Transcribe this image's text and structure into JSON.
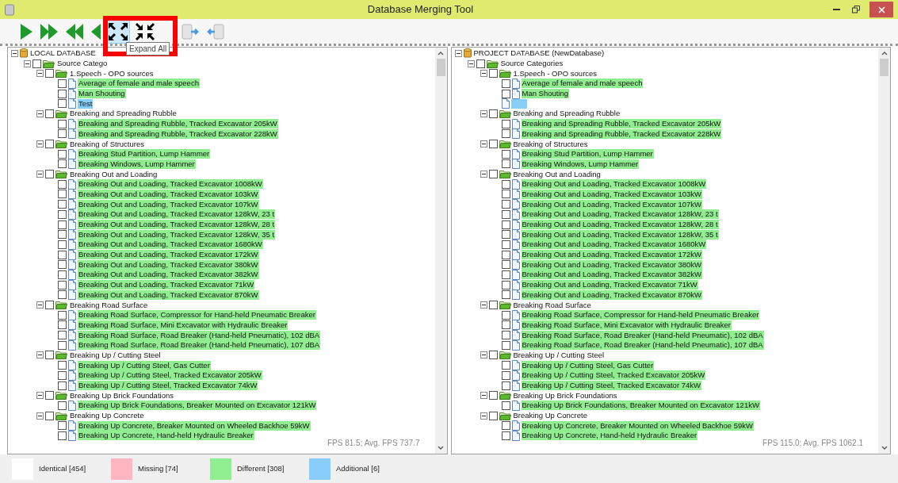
{
  "window": {
    "title": "Database Merging Tool"
  },
  "toolbar": {
    "buttons": [
      {
        "kind": "play",
        "highlighted": false
      },
      {
        "kind": "fast-forward",
        "highlighted": false
      },
      {
        "kind": "rewind",
        "highlighted": false
      },
      {
        "kind": "back",
        "highlighted": false
      },
      {
        "kind": "expand",
        "highlighted": true
      },
      {
        "kind": "collapse",
        "highlighted": false
      },
      {
        "kind": "db-right",
        "highlighted": false
      },
      {
        "kind": "db-left",
        "highlighted": false
      }
    ],
    "tooltip": "Expand All"
  },
  "panels": [
    {
      "fps": "FPS 81.5; Avg. FPS 737.7",
      "tree": {
        "label": "LOCAL DATABASE",
        "kind": "database",
        "children": [
          {
            "label": "Source Catego",
            "kind": "folder",
            "checked": false,
            "children": [
              {
                "label": "1.Speech - OPO sources",
                "kind": "folder",
                "checked": false,
                "children": [
                  {
                    "label": "Average of female and male speech",
                    "kind": "file",
                    "checked": false,
                    "color": "#90ee90"
                  },
                  {
                    "label": "Man Shouting",
                    "kind": "file",
                    "checked": false,
                    "color": "#90ee90"
                  },
                  {
                    "label": "Test",
                    "kind": "file",
                    "checked": false,
                    "color": "#87cefa"
                  }
                ]
              },
              {
                "label": "Breaking and Spreading Rubble",
                "kind": "folder",
                "checked": false,
                "children": [
                  {
                    "label": "Breaking and Spreading Rubble, Tracked Excavator 205kW",
                    "kind": "file",
                    "checked": false,
                    "color": "#90ee90"
                  },
                  {
                    "label": "Breaking and Spreading Rubble, Tracked Excavator 228kW",
                    "kind": "file",
                    "checked": false,
                    "color": "#90ee90"
                  }
                ]
              },
              {
                "label": "Breaking of Structures",
                "kind": "folder",
                "checked": false,
                "children": [
                  {
                    "label": "Breaking Stud Partition, Lump Hammer",
                    "kind": "file",
                    "checked": false,
                    "color": "#90ee90"
                  },
                  {
                    "label": "Breaking Windows, Lump Hammer",
                    "kind": "file",
                    "checked": false,
                    "color": "#90ee90"
                  }
                ]
              },
              {
                "label": "Breaking Out and Loading",
                "kind": "folder",
                "checked": false,
                "children": [
                  {
                    "label": "Breaking Out and Loading, Tracked Excavator 1008kW",
                    "kind": "file",
                    "checked": false,
                    "color": "#90ee90"
                  },
                  {
                    "label": "Breaking Out and Loading, Tracked Excavator 103kW",
                    "kind": "file",
                    "checked": false,
                    "color": "#90ee90"
                  },
                  {
                    "label": "Breaking Out and Loading, Tracked Excavator 107kW",
                    "kind": "file",
                    "checked": false,
                    "color": "#90ee90"
                  },
                  {
                    "label": "Breaking Out and Loading, Tracked Excavator 128kW, 23 t",
                    "kind": "file",
                    "checked": false,
                    "color": "#90ee90"
                  },
                  {
                    "label": "Breaking Out and Loading, Tracked Excavator 128kW, 28 t",
                    "kind": "file",
                    "checked": false,
                    "color": "#90ee90"
                  },
                  {
                    "label": "Breaking Out and Loading, Tracked Excavator 128kW, 35 t",
                    "kind": "file",
                    "checked": false,
                    "color": "#90ee90"
                  },
                  {
                    "label": "Breaking Out and Loading, Tracked Excavator 1680kW",
                    "kind": "file",
                    "checked": false,
                    "color": "#90ee90"
                  },
                  {
                    "label": "Breaking Out and Loading, Tracked Excavator 172kW",
                    "kind": "file",
                    "checked": false,
                    "color": "#90ee90"
                  },
                  {
                    "label": "Breaking Out and Loading, Tracked Excavator 380kW",
                    "kind": "file",
                    "checked": false,
                    "color": "#90ee90"
                  },
                  {
                    "label": "Breaking Out and Loading, Tracked Excavator 382kW",
                    "kind": "file",
                    "checked": false,
                    "color": "#90ee90"
                  },
                  {
                    "label": "Breaking Out and Loading, Tracked Excavator 71kW",
                    "kind": "file",
                    "checked": false,
                    "color": "#90ee90"
                  },
                  {
                    "label": "Breaking Out and Loading, Tracked Excavator 870kW",
                    "kind": "file",
                    "checked": false,
                    "color": "#90ee90"
                  }
                ]
              },
              {
                "label": "Breaking Road Surface",
                "kind": "folder",
                "checked": false,
                "children": [
                  {
                    "label": "Breaking Road Surface, Compressor for Hand-held Pneumatic Breaker",
                    "kind": "file",
                    "checked": false,
                    "color": "#90ee90"
                  },
                  {
                    "label": "Breaking Road Surface, Mini Excavator with Hydraulic Breaker",
                    "kind": "file",
                    "checked": false,
                    "color": "#90ee90"
                  },
                  {
                    "label": "Breaking Road Surface, Road Breaker (Hand-held Pneumatic), 102 dBA",
                    "kind": "file",
                    "checked": false,
                    "color": "#90ee90"
                  },
                  {
                    "label": "Breaking Road Surface, Road Breaker (Hand-held Pneumatic), 107 dBA",
                    "kind": "file",
                    "checked": false,
                    "color": "#90ee90"
                  }
                ]
              },
              {
                "label": "Breaking Up / Cutting Steel",
                "kind": "folder",
                "checked": false,
                "children": [
                  {
                    "label": "Breaking Up / Cutting Steel, Gas Cutter",
                    "kind": "file",
                    "checked": false,
                    "color": "#90ee90"
                  },
                  {
                    "label": "Breaking Up / Cutting Steel, Tracked Excavator 205kW",
                    "kind": "file",
                    "checked": false,
                    "color": "#90ee90"
                  },
                  {
                    "label": "Breaking Up / Cutting Steel, Tracked Excavator 74kW",
                    "kind": "file",
                    "checked": false,
                    "color": "#90ee90"
                  }
                ]
              },
              {
                "label": "Breaking Up Brick Foundations",
                "kind": "folder",
                "checked": false,
                "children": [
                  {
                    "label": "Breaking Up Brick Foundations, Breaker Mounted on Excavator 121kW",
                    "kind": "file",
                    "checked": false,
                    "color": "#90ee90"
                  }
                ]
              },
              {
                "label": "Breaking Up Concrete",
                "kind": "folder",
                "checked": false,
                "children": [
                  {
                    "label": "Breaking Up Concrete, Breaker Mounted on Wheeled Backhoe 59kW",
                    "kind": "file",
                    "checked": false,
                    "color": "#90ee90"
                  },
                  {
                    "label": "Breaking Up Concrete, Hand-held Hydraulic Breaker",
                    "kind": "file",
                    "checked": false,
                    "color": "#90ee90"
                  }
                ]
              }
            ]
          }
        ]
      }
    },
    {
      "fps": "FPS 115.0; Avg. FPS 1062.1",
      "tree": {
        "label": "PROJECT DATABASE (NewDatabase)",
        "kind": "database",
        "children": [
          {
            "label": "Source Categories",
            "kind": "folder",
            "checked": false,
            "children": [
              {
                "label": "1.Speech - OPO sources",
                "kind": "folder",
                "checked": false,
                "children": [
                  {
                    "label": "Average of female and male speech",
                    "kind": "file",
                    "checked": false,
                    "color": "#90ee90"
                  },
                  {
                    "label": "Man Shouting",
                    "kind": "file",
                    "checked": false,
                    "color": "#90ee90"
                  },
                  {
                    "kind": "file",
                    "color": "#87cefa"
                  }
                ]
              },
              {
                "label": "Breaking and Spreading Rubble",
                "kind": "folder",
                "checked": false,
                "children": [
                  {
                    "label": "Breaking and Spreading Rubble, Tracked Excavator 205kW",
                    "kind": "file",
                    "checked": false,
                    "color": "#90ee90"
                  },
                  {
                    "label": "Breaking and Spreading Rubble, Tracked Excavator 228kW",
                    "kind": "file",
                    "checked": false,
                    "color": "#90ee90"
                  }
                ]
              },
              {
                "label": "Breaking of Structures",
                "kind": "folder",
                "checked": false,
                "children": [
                  {
                    "label": "Breaking Stud Partition, Lump Hammer",
                    "kind": "file",
                    "checked": false,
                    "color": "#90ee90"
                  },
                  {
                    "label": "Breaking Windows, Lump Hammer",
                    "kind": "file",
                    "checked": false,
                    "color": "#90ee90"
                  }
                ]
              },
              {
                "label": "Breaking Out and Loading",
                "kind": "folder",
                "checked": false,
                "children": [
                  {
                    "label": "Breaking Out and Loading, Tracked Excavator 1008kW",
                    "kind": "file",
                    "checked": false,
                    "color": "#90ee90"
                  },
                  {
                    "label": "Breaking Out and Loading, Tracked Excavator 103kW",
                    "kind": "file",
                    "checked": false,
                    "color": "#90ee90"
                  },
                  {
                    "label": "Breaking Out and Loading, Tracked Excavator 107kW",
                    "kind": "file",
                    "checked": false,
                    "color": "#90ee90"
                  },
                  {
                    "label": "Breaking Out and Loading, Tracked Excavator 128kW, 23 t",
                    "kind": "file",
                    "checked": false,
                    "color": "#90ee90"
                  },
                  {
                    "label": "Breaking Out and Loading, Tracked Excavator 128kW, 28 t",
                    "kind": "file",
                    "checked": false,
                    "color": "#90ee90"
                  },
                  {
                    "label": "Breaking Out and Loading, Tracked Excavator 128kW, 35 t",
                    "kind": "file",
                    "checked": false,
                    "color": "#90ee90"
                  },
                  {
                    "label": "Breaking Out and Loading, Tracked Excavator 1680kW",
                    "kind": "file",
                    "checked": false,
                    "color": "#90ee90"
                  },
                  {
                    "label": "Breaking Out and Loading, Tracked Excavator 172kW",
                    "kind": "file",
                    "checked": false,
                    "color": "#90ee90"
                  },
                  {
                    "label": "Breaking Out and Loading, Tracked Excavator 380kW",
                    "kind": "file",
                    "checked": false,
                    "color": "#90ee90"
                  },
                  {
                    "label": "Breaking Out and Loading, Tracked Excavator 382kW",
                    "kind": "file",
                    "checked": false,
                    "color": "#90ee90"
                  },
                  {
                    "label": "Breaking Out and Loading, Tracked Excavator 71kW",
                    "kind": "file",
                    "checked": false,
                    "color": "#90ee90"
                  },
                  {
                    "label": "Breaking Out and Loading, Tracked Excavator 870kW",
                    "kind": "file",
                    "checked": false,
                    "color": "#90ee90"
                  }
                ]
              },
              {
                "label": "Breaking Road Surface",
                "kind": "folder",
                "checked": false,
                "children": [
                  {
                    "label": "Breaking Road Surface, Compressor for Hand-held Pneumatic Breaker",
                    "kind": "file",
                    "checked": false,
                    "color": "#90ee90"
                  },
                  {
                    "label": "Breaking Road Surface, Mini Excavator with Hydraulic Breaker",
                    "kind": "file",
                    "checked": false,
                    "color": "#90ee90"
                  },
                  {
                    "label": "Breaking Road Surface, Road Breaker (Hand-held Pneumatic), 102 dBA",
                    "kind": "file",
                    "checked": false,
                    "color": "#90ee90"
                  },
                  {
                    "label": "Breaking Road Surface, Road Breaker (Hand-held Pneumatic), 107 dBA",
                    "kind": "file",
                    "checked": false,
                    "color": "#90ee90"
                  }
                ]
              },
              {
                "label": "Breaking Up / Cutting Steel",
                "kind": "folder",
                "checked": false,
                "children": [
                  {
                    "label": "Breaking Up / Cutting Steel, Gas Cutter",
                    "kind": "file",
                    "checked": false,
                    "color": "#90ee90"
                  },
                  {
                    "label": "Breaking Up / Cutting Steel, Tracked Excavator 205kW",
                    "kind": "file",
                    "checked": false,
                    "color": "#90ee90"
                  },
                  {
                    "label": "Breaking Up / Cutting Steel, Tracked Excavator 74kW",
                    "kind": "file",
                    "checked": false,
                    "color": "#90ee90"
                  }
                ]
              },
              {
                "label": "Breaking Up Brick Foundations",
                "kind": "folder",
                "checked": false,
                "children": [
                  {
                    "label": "Breaking Up Brick Foundations, Breaker Mounted on Excavator 121kW",
                    "kind": "file",
                    "checked": false,
                    "color": "#90ee90"
                  }
                ]
              },
              {
                "label": "Breaking Up Concrete",
                "kind": "folder",
                "checked": false,
                "children": [
                  {
                    "label": "Breaking Up Concrete, Breaker Mounted on Wheeled Backhoe 59kW",
                    "kind": "file",
                    "checked": false,
                    "color": "#90ee90"
                  },
                  {
                    "label": "Breaking Up Concrete, Hand-held Hydraulic Breaker",
                    "kind": "file",
                    "checked": false,
                    "color": "#90ee90"
                  }
                ]
              }
            ]
          }
        ]
      }
    }
  ],
  "legend": [
    {
      "label": "Identical [454]",
      "color": "#ffffff"
    },
    {
      "label": "Missing [74]",
      "color": "#ffb6c1"
    },
    {
      "label": "Different [308]",
      "color": "#90ee90"
    },
    {
      "label": "Additional [6]",
      "color": "#87cefa"
    }
  ]
}
